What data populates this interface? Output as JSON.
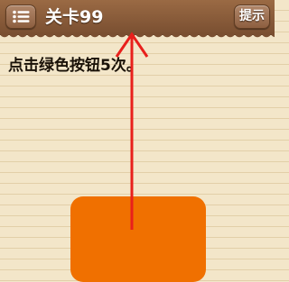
{
  "header": {
    "menu_icon": "list-icon",
    "level_title": "关卡99",
    "hint_label": "提示"
  },
  "question": {
    "text": "点击绿色按钮5次。"
  },
  "game": {
    "button_color": "#f07000",
    "overlay_arrow_color": "#e8201c",
    "overlay_arrow_icon": "up-arrow-icon"
  }
}
